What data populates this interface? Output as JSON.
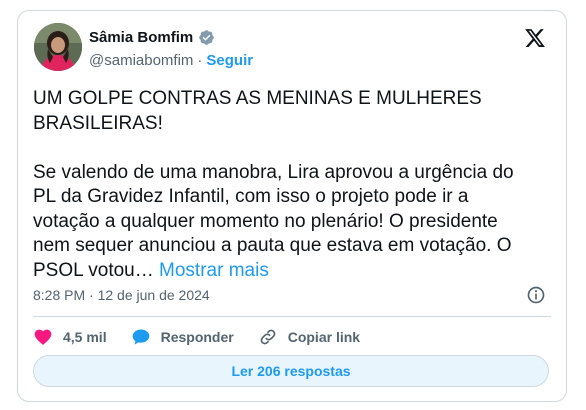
{
  "author": {
    "name": "Sâmia Bomfim",
    "handle": "@samiabomfim",
    "separator": "·",
    "follow_label": "Seguir"
  },
  "tweet": {
    "text": "UM GOLPE CONTRAS AS MENINAS E MULHERES BRASILEIRAS!\n\nSe valendo de uma manobra, Lira aprovou a urgência do PL da Gravidez Infantil, com isso o projeto pode ir a votação a qualquer momento no plenário! O presidente nem sequer anunciou a pauta que estava em votação. O PSOL votou… ",
    "more_label": "Mostrar mais",
    "timestamp": "8:28 PM · 12 de jun de 2024"
  },
  "actions": {
    "likes": "4,5 mil",
    "reply_label": "Responder",
    "copy_label": "Copiar link"
  },
  "replies_button": "Ler 206 respostas",
  "colors": {
    "accent": "#1d9bf0",
    "like": "#f91880",
    "text": "#0f1419",
    "muted": "#536471",
    "border": "#cfd9de",
    "verified": "#829aab"
  },
  "icons": [
    "verified-badge-icon",
    "x-logo-icon",
    "info-icon",
    "heart-icon",
    "reply-bubble-icon",
    "link-icon"
  ]
}
